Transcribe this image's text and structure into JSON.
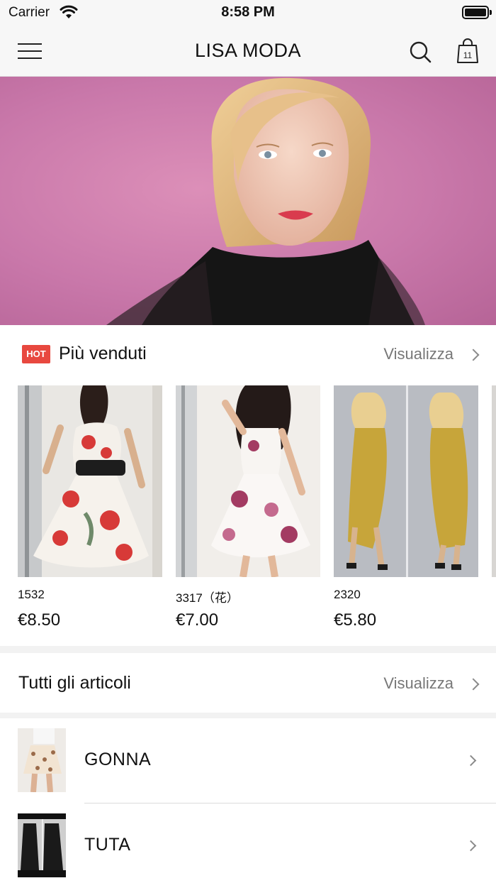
{
  "status_bar": {
    "carrier": "Carrier",
    "time": "8:58 PM"
  },
  "header": {
    "brand": "LISA MODA",
    "cart_count": "11"
  },
  "best_sellers": {
    "badge": "HOT",
    "title": "Più venduti",
    "link": "Visualizza",
    "products": [
      {
        "code": "1532",
        "price": "€8.50"
      },
      {
        "code": "3317（花）",
        "price": "€7.00"
      },
      {
        "code": "2320",
        "price": "€5.80"
      }
    ]
  },
  "all_items": {
    "title": "Tutti gli articoli",
    "link": "Visualizza"
  },
  "categories": [
    {
      "label": "GONNA"
    },
    {
      "label": "TUTA"
    }
  ],
  "colors": {
    "accent": "#e8483f",
    "hero_bg": "#c978aa",
    "text": "#111111",
    "muted": "#777777"
  },
  "icons": [
    "menu-icon",
    "search-icon",
    "shopping-bag-icon",
    "chevron-right-icon",
    "wifi-icon",
    "battery-icon"
  ]
}
